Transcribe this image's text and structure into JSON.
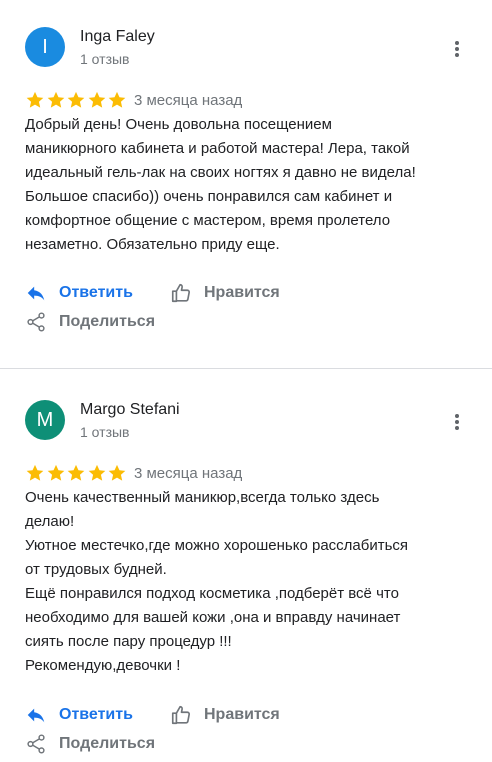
{
  "colors": {
    "accent": "#1a73e8",
    "star": "#fbbc04",
    "secondary_text": "#70757a"
  },
  "reviews": [
    {
      "avatar_letter": "I",
      "avatar_color": "#1a8be0",
      "author": "Inga Faley",
      "reviews_count": "1 отзыв",
      "rating": 5,
      "date": "3 месяца назад",
      "text_lines": [
        "Добрый день! Очень довольна посещением",
        "маникюрного кабинета и работой мастера! Лера, такой",
        "идеальный гель-лак на своих ногтях я давно не видела!",
        "Большое спасибо)) очень понравился сам кабинет и",
        "комфортное общение с мастером, время пролетело",
        "незаметно. Обязательно приду еще."
      ],
      "actions": {
        "reply": "Ответить",
        "like": "Нравится",
        "share": "Поделиться"
      }
    },
    {
      "avatar_letter": "M",
      "avatar_color": "#0e8f77",
      "author": "Margo Stefani",
      "reviews_count": "1 отзыв",
      "rating": 5,
      "date": "3 месяца назад",
      "text_lines": [
        "Очень качественный маникюр,всегда только здесь",
        "делаю!",
        "Уютное местечко,где можно хорошенько расслабиться",
        "от трудовых будней.",
        "Ещё понравился подход косметика ,подберёт всё что",
        "необходимо для вашей кожи ,она и вправду начинает",
        "сиять после пару процедур !!!",
        "Рекомендую,девочки !"
      ],
      "actions": {
        "reply": "Ответить",
        "like": "Нравится",
        "share": "Поделиться"
      }
    }
  ]
}
